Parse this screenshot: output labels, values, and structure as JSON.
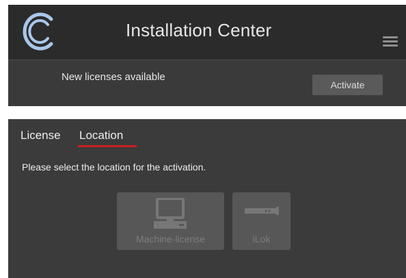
{
  "header": {
    "title": "Installation Center",
    "logo_icon": "c-ring-logo-icon",
    "menu_icon": "hamburger-icon"
  },
  "notification": {
    "message": "New licenses available",
    "activate_label": "Activate"
  },
  "panel": {
    "tabs": [
      {
        "label": "License",
        "active": false
      },
      {
        "label": "Location",
        "active": true
      }
    ],
    "instruction": "Please select the location for the activation.",
    "options": [
      {
        "label": "Machine-license",
        "icon": "computer-icon"
      },
      {
        "label": "iLok",
        "icon": "usb-dongle-icon"
      }
    ]
  },
  "colors": {
    "header_bg": "#2b2b2b",
    "notify_bg": "#3a3a3a",
    "panel_bg": "#3b3b3b",
    "button_bg": "#5a5a5a",
    "option_bg": "#575757",
    "accent_underline": "#cc1f1f",
    "logo_blue": "#a9c7ea"
  }
}
